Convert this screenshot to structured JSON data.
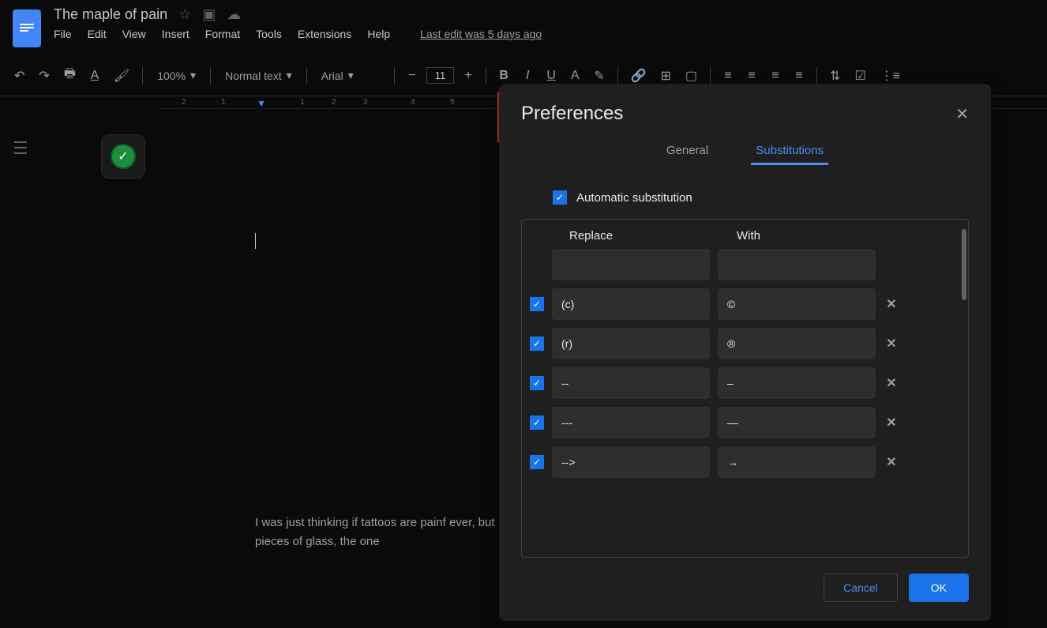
{
  "header": {
    "doc_title": "The maple of pain",
    "menu": [
      "File",
      "Edit",
      "View",
      "Insert",
      "Format",
      "Tools",
      "Extensions",
      "Help"
    ],
    "last_edit": "Last edit was 5 days ago"
  },
  "toolbar": {
    "zoom": "100%",
    "style": "Normal text",
    "font": "Arial",
    "size": "11"
  },
  "ruler": {
    "marks": [
      "2",
      "1",
      "1",
      "2",
      "3",
      "4",
      "5"
    ]
  },
  "doc_body": {
    "text": "I was just thinking if tattoos are painf ever, but I think I need one, somethin with broken pieces of glass, the one"
  },
  "modal": {
    "title": "Preferences",
    "tabs": {
      "general": "General",
      "subs": "Substitutions"
    },
    "auto_sub": "Automatic substitution",
    "cols": {
      "replace": "Replace",
      "with": "With"
    },
    "rows": [
      {
        "checked": true,
        "replace": "(c)",
        "with": "©"
      },
      {
        "checked": true,
        "replace": "(r)",
        "with": "®"
      },
      {
        "checked": true,
        "replace": "--",
        "with": "–"
      },
      {
        "checked": true,
        "replace": "---",
        "with": "—"
      },
      {
        "checked": true,
        "replace": "-->",
        "with": "→"
      }
    ],
    "cancel": "Cancel",
    "ok": "OK"
  }
}
